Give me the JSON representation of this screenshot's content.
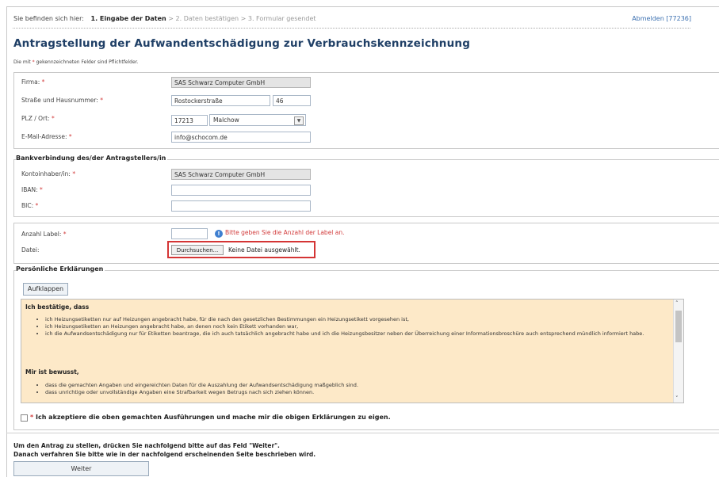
{
  "breadcrumb": {
    "prefix": "Sie befinden sich hier:",
    "step1": "1. Eingabe der Daten",
    "sep": ">",
    "step2": "2. Daten bestätigen",
    "step3": "3. Formular gesendet"
  },
  "logout": "Abmelden [77236]",
  "title": "Antragstellung der Aufwandentschädigung zur Verbrauchskennzeichnung",
  "required_note": {
    "before": "Die mit",
    "star": "*",
    "after": "gekennzeichneten Felder sind Pflichtfelder."
  },
  "company": {
    "firma_label": "Firma:",
    "firma_value": "SAS Schwarz Computer GmbH",
    "street_label": "Straße und Hausnummer:",
    "street_value": "Rostockerstraße",
    "number_value": "46",
    "plz_label": "PLZ / Ort:",
    "plz_value": "17213",
    "ort_value": "Malchow",
    "email_label": "E-Mail-Adresse:",
    "email_value": "info@schocom.de"
  },
  "bank": {
    "legend": "Bankverbindung des/der Antragstellers/in",
    "holder_label": "Kontoinhaber/in:",
    "holder_value": "SAS Schwarz Computer GmbH",
    "iban_label": "IBAN:",
    "iban_value": "",
    "bic_label": "BIC:",
    "bic_value": ""
  },
  "labels": {
    "count_label": "Anzahl Label:",
    "count_value": "",
    "hint": "Bitte geben Sie die Anzahl der Label an.",
    "file_label": "Datei:",
    "browse_button": "Durchsuchen...",
    "no_file": "Keine Datei ausgewählt."
  },
  "personal": {
    "legend": "Persönliche Erklärungen",
    "expand_button": "Aufklappen",
    "confirm_heading": "Ich bestätige, dass",
    "confirm_items": [
      "ich Heizungsetiketten nur auf Heizungen angebracht habe, für die nach den gesetzlichen Bestimmungen ein Heizungsetikett vorgesehen ist,",
      "ich Heizungsetiketten an Heizungen angebracht habe, an denen noch kein Etikett vorhanden war,",
      "ich die Aufwandsentschädigung nur für Etiketten beantrage, die ich auch tatsächlich angebracht habe und ich die Heizungsbesitzer neben der Überreichung einer Informationsbroschüre auch entsprechend mündlich informiert habe."
    ],
    "aware_heading": "Mir ist bewusst,",
    "aware_items": [
      "dass die gemachten Angaben und eingereichten Daten für die Auszahlung der Aufwandsentschädigung maßgeblich sind.",
      "dass unrichtige oder unvollständige Angaben eine Strafbarkeit wegen Betrugs nach sich ziehen können."
    ],
    "accept_text": "Ich akzeptiere die oben gemachten Ausführungen und mache mir die obigen Erklärungen zu eigen."
  },
  "footer": {
    "line1": "Um den Antrag zu stellen, drücken Sie nachfolgend bitte auf das Feld \"Weiter\".",
    "line2": "Danach verfahren Sie bitte wie in der nachfolgend erscheinenden Seite beschrieben wird.",
    "next_button": "Weiter"
  },
  "colors": {
    "title": "#1f3f66",
    "required": "#d23b3b",
    "declaration_bg": "#fde9c8",
    "highlight_border": "#d43535",
    "link": "#3a6fb0"
  },
  "icons": {
    "hint_icon": "info-circle-icon",
    "select_arrow": "chevron-down-icon"
  }
}
